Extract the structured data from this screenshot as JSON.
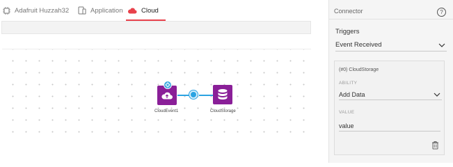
{
  "tabs": [
    {
      "label": "Adafruit Huzzah32",
      "icon": "chip-icon"
    },
    {
      "label": "Application",
      "icon": "devices-icon"
    },
    {
      "label": "Cloud",
      "icon": "cloud-icon",
      "active": true
    }
  ],
  "colors": {
    "active_tab_underline": "#e8414b",
    "node_purple": "#8a1f98",
    "wire_blue": "#2aa3e2"
  },
  "canvas": {
    "nodes": [
      {
        "label": "CloudEvent1",
        "icon": "cloud-upload-icon",
        "badge_icon": "gear-icon"
      },
      {
        "label": "CloudStorage",
        "icon": "database-icon"
      }
    ]
  },
  "panel": {
    "title": "Connector",
    "help_icon": "question-circle-icon",
    "triggers_label": "Triggers",
    "trigger_value": "Event Received",
    "card": {
      "title": "(#0) CloudStorage",
      "ability_label": "ABILITY",
      "ability_value": "Add Data",
      "value_label": "VALUE",
      "value_text": "value",
      "delete_icon": "trash-icon"
    }
  }
}
